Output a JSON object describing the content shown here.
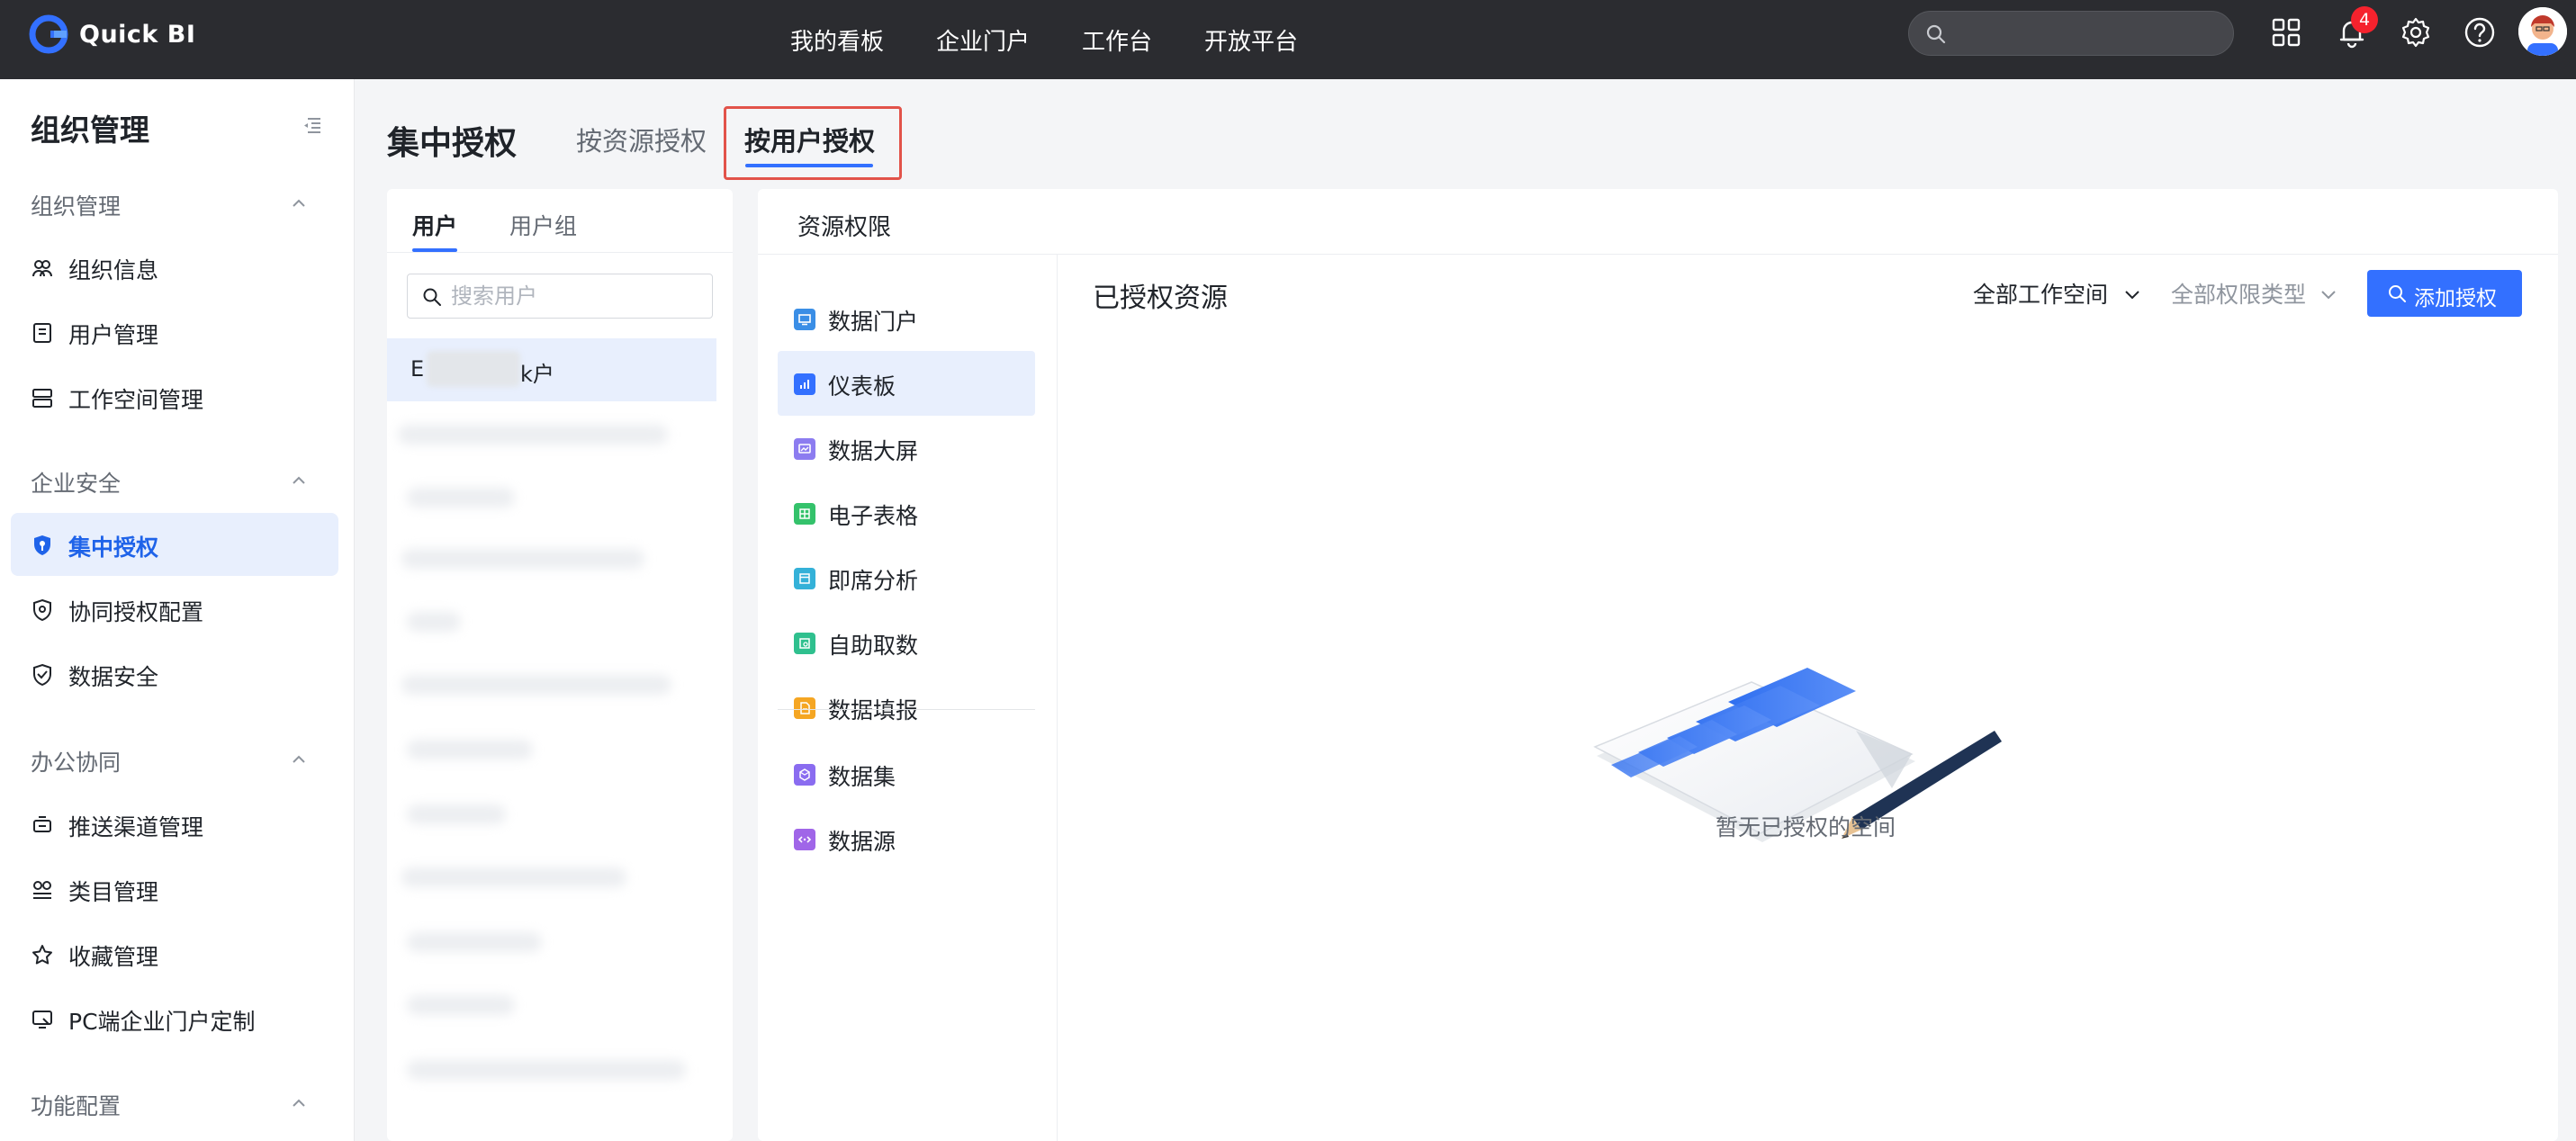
{
  "app": {
    "name": "Quick BI"
  },
  "topnav": {
    "items": [
      "我的看板",
      "企业门户",
      "工作台",
      "开放平台"
    ],
    "notification_count": "4",
    "search_placeholder": ""
  },
  "sidebar": {
    "title": "组织管理",
    "groups": [
      {
        "label": "组织管理",
        "items": [
          "组织信息",
          "用户管理",
          "工作空间管理"
        ]
      },
      {
        "label": "企业安全",
        "items": [
          "集中授权",
          "协同授权配置",
          "数据安全"
        ]
      },
      {
        "label": "办公协同",
        "items": [
          "推送渠道管理",
          "类目管理",
          "收藏管理",
          "PC端企业门户定制"
        ]
      },
      {
        "label": "功能配置",
        "items": []
      }
    ],
    "active_item": "集中授权"
  },
  "page": {
    "title": "集中授权",
    "tabs": [
      "按资源授权",
      "按用户授权"
    ],
    "active_tab": "按用户授权"
  },
  "user_panel": {
    "tabs": [
      "用户",
      "用户组"
    ],
    "active_tab": "用户",
    "search_placeholder": "搜索用户",
    "selected_user": {
      "prefix": "E",
      "suffix": "k户"
    }
  },
  "resource_panel": {
    "header": "资源权限",
    "resource_types": [
      {
        "label": "数据门户",
        "icon": "portal-icon",
        "color": "#3a8ee6"
      },
      {
        "label": "仪表板",
        "icon": "dashboard-icon",
        "color": "#3370ff"
      },
      {
        "label": "数据大屏",
        "icon": "screen-icon",
        "color": "#8c7cf0"
      },
      {
        "label": "电子表格",
        "icon": "spreadsheet-icon",
        "color": "#34c26b"
      },
      {
        "label": "即席分析",
        "icon": "adhoc-icon",
        "color": "#34b1d8"
      },
      {
        "label": "自助取数",
        "icon": "self-fetch-icon",
        "color": "#2fc08e"
      },
      {
        "label": "数据填报",
        "icon": "form-icon",
        "color": "#f5a623"
      },
      {
        "label": "数据集",
        "icon": "dataset-icon",
        "color": "#8a6cf0"
      },
      {
        "label": "数据源",
        "icon": "datasource-icon",
        "color": "#a066e8"
      }
    ],
    "active_type": "仪表板",
    "granted_title": "已授权资源",
    "workspace_filter": "全部工作空间",
    "permission_filter": "全部权限类型",
    "add_button": "添加授权",
    "empty_text": "暂无已授权的空间"
  },
  "colors": {
    "topbar": "#2b2c30",
    "accent": "#3370ff",
    "active_bg": "#e8effd",
    "highlight_border": "#e2534a",
    "badge": "#f5222d"
  }
}
